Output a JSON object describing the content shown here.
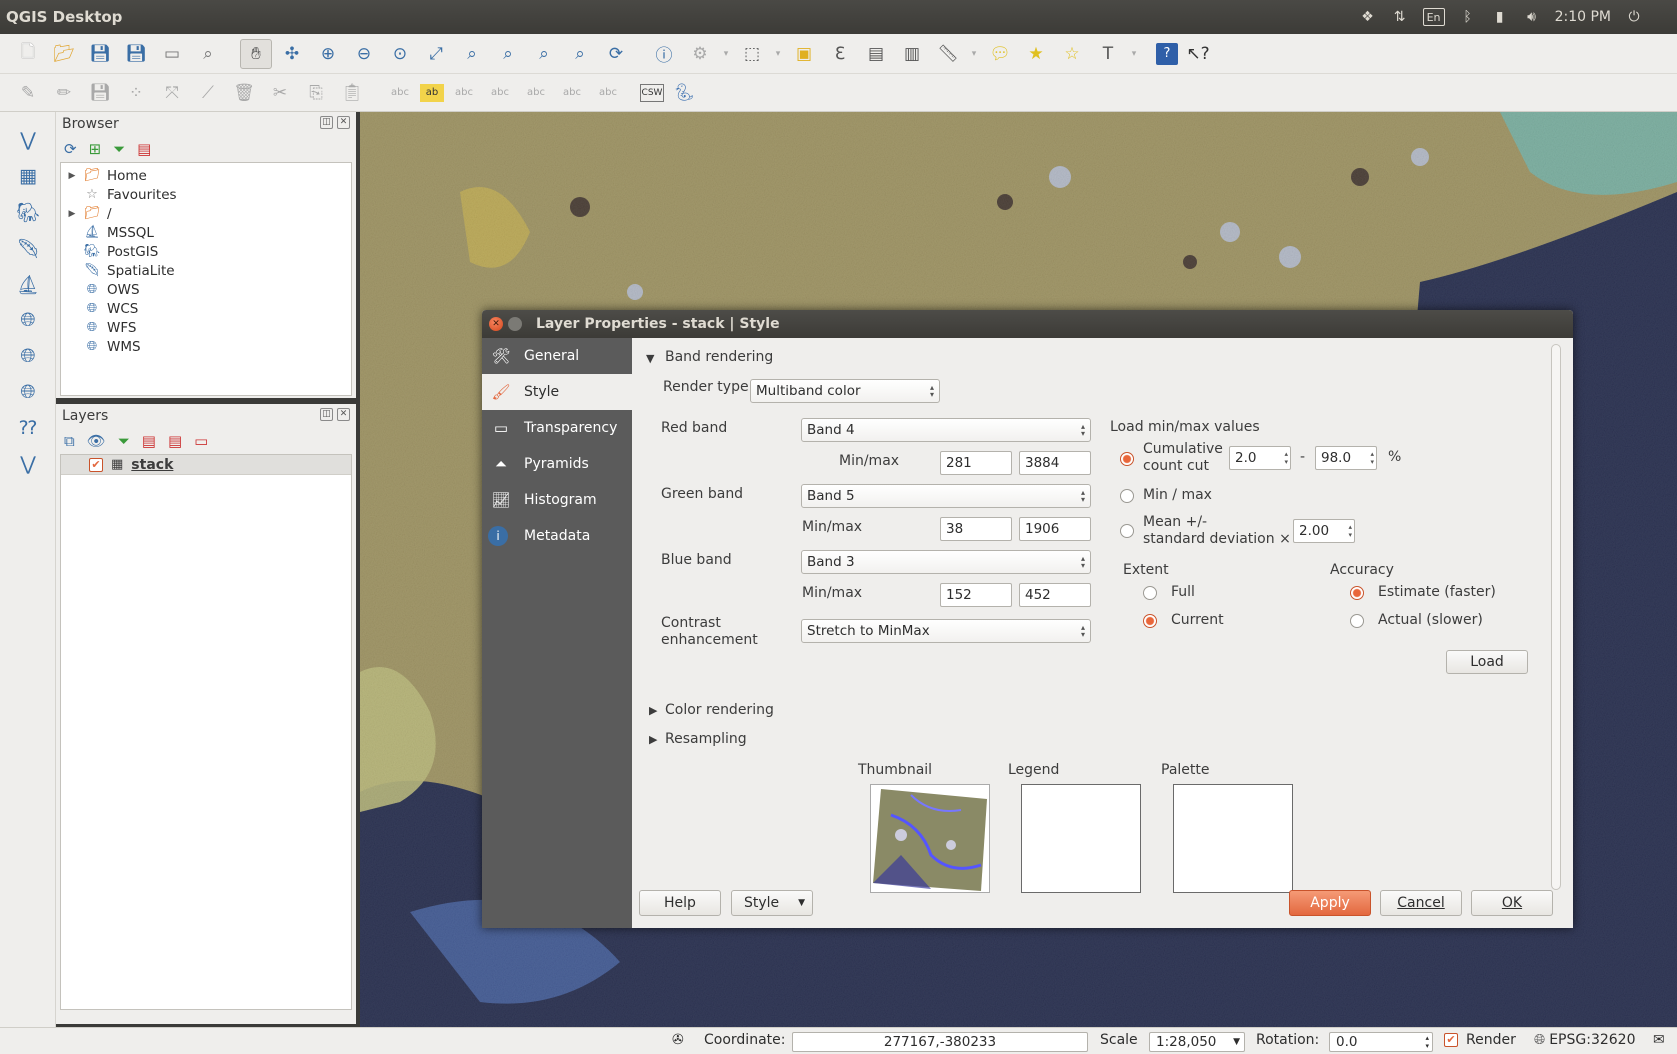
{
  "os": {
    "app_title": "QGIS Desktop",
    "clock": "2:10 PM",
    "lang": "En"
  },
  "browser": {
    "title": "Browser",
    "items": [
      {
        "label": "Home",
        "icon": "folder-icon",
        "expandable": true
      },
      {
        "label": "Favourites",
        "icon": "star-icon",
        "expandable": false
      },
      {
        "label": "/",
        "icon": "folder-icon",
        "expandable": true
      },
      {
        "label": "MSSQL",
        "icon": "mssql-icon",
        "expandable": false
      },
      {
        "label": "PostGIS",
        "icon": "postgis-icon",
        "expandable": false
      },
      {
        "label": "SpatiaLite",
        "icon": "spatialite-icon",
        "expandable": false
      },
      {
        "label": "OWS",
        "icon": "ows-icon",
        "expandable": false
      },
      {
        "label": "WCS",
        "icon": "wcs-icon",
        "expandable": false
      },
      {
        "label": "WFS",
        "icon": "wfs-icon",
        "expandable": false
      },
      {
        "label": "WMS",
        "icon": "wms-icon",
        "expandable": false
      }
    ]
  },
  "layers": {
    "title": "Layers",
    "items": [
      {
        "label": "stack",
        "checked": true
      }
    ]
  },
  "dialog": {
    "title": "Layer Properties - stack | Style",
    "sidebar": [
      "General",
      "Style",
      "Transparency",
      "Pyramids",
      "Histogram",
      "Metadata"
    ],
    "band_rendering": {
      "section_label": "Band rendering",
      "render_type_label": "Render type",
      "render_type": "Multiband color",
      "red_label": "Red band",
      "red_band": "Band 4",
      "red_min": "281",
      "red_max": "3884",
      "green_label": "Green band",
      "green_band": "Band 5",
      "green_min": "38",
      "green_max": "1906",
      "blue_label": "Blue band",
      "blue_band": "Band 3",
      "blue_min": "152",
      "blue_max": "452",
      "minmax_label": "Min/max",
      "contrast_label_1": "Contrast",
      "contrast_label_2": "enhancement",
      "contrast": "Stretch to MinMax"
    },
    "minmax_values": {
      "title": "Load min/max values",
      "cumulative_1": "Cumulative",
      "cumulative_2": "count cut",
      "cut_low": "2.0",
      "cut_dash": "-",
      "cut_high": "98.0",
      "percent": "%",
      "minmax_option": "Min / max",
      "mean_1": "Mean +/-",
      "mean_2": "standard deviation ×",
      "stddev": "2.00",
      "extent_title": "Extent",
      "extent_full": "Full",
      "extent_current": "Current",
      "accuracy_title": "Accuracy",
      "accuracy_estimate": "Estimate (faster)",
      "accuracy_actual": "Actual (slower)",
      "load_button": "Load"
    },
    "collapsed_sections": [
      "Color rendering",
      "Resampling"
    ],
    "previews": {
      "thumbnail": "Thumbnail",
      "legend": "Legend",
      "palette": "Palette"
    },
    "buttons": {
      "help": "Help",
      "style": "Style",
      "apply": "Apply",
      "cancel": "Cancel",
      "ok": "OK"
    }
  },
  "status": {
    "coordinate_label": "Coordinate:",
    "coordinate": "277167,-380233",
    "scale_label": "Scale",
    "scale": "1:28,050",
    "rotation_label": "Rotation:",
    "rotation": "0.0",
    "render_label": "Render",
    "render_checked": true,
    "crs": "EPSG:32620"
  },
  "colors": {
    "accent": "#e3683f",
    "titlebar": "#3c3b37",
    "sidebar": "#5b5b5b",
    "panel": "#efeeec"
  }
}
